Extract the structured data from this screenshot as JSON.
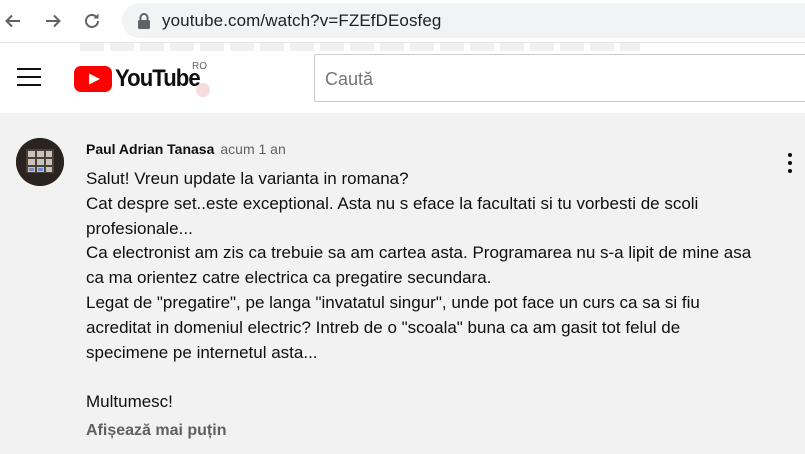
{
  "browser": {
    "url": "youtube.com/watch?v=FZEfDEosfeg"
  },
  "header": {
    "logo_text": "YouTube",
    "region": "RO",
    "search_placeholder": "Caută"
  },
  "comment": {
    "author": "Paul Adrian Tanasa",
    "time": "acum 1 an",
    "text": "Salut! Vreun update la varianta in romana?\nCat despre set..este exceptional. Asta nu s eface la facultati si tu vorbesti de scoli profesionale...\nCa electronist am zis ca trebuie sa am cartea asta. Programarea nu s-a lipit de mine asa ca ma orientez catre electrica ca pregatire secundara.\nLegat de \"pregatire\", pe langa \"invatatul singur\", unde pot face un curs ca sa si fiu acreditat in domeniul electric? Intreb de o \"scoala\" buna ca am gasit tot felul de specimene pe internetul asta...\n\nMultumesc!",
    "show_more": "Afișează mai puțin"
  },
  "colors": {
    "brand_red": "#ff0000",
    "comment_bg": "#f2f2f2",
    "secondary_text": "#606060"
  },
  "icons": [
    "back-arrow-icon",
    "forward-arrow-icon",
    "reload-icon",
    "lock-icon",
    "menu-icon",
    "youtube-logo",
    "more-vert-icon"
  ]
}
